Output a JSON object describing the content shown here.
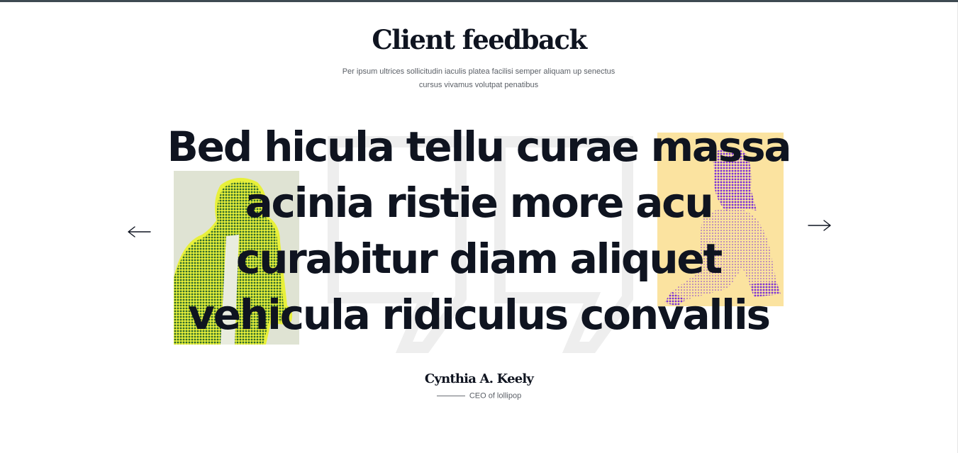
{
  "section": {
    "title": "Client feedback",
    "subtitle": "Per ipsum ultrices sollicitudin iaculis platea facilisi semper aliquam up senectus cursus vivamus volutpat penatibus"
  },
  "testimonial": {
    "quote": "Bed hicula tellu curae massa acinia ristie more acu curabitur diam aliquet vehicula ridiculus convallis",
    "author_name": "Cynthia A. Keely",
    "author_role": "CEO of lollipop"
  },
  "navigation": {
    "prev_icon": "arrow-left-icon",
    "next_icon": "arrow-right-icon"
  },
  "images": {
    "left": "halftone portrait of man in jacket, green tint",
    "right": "halftone portrait of woman sitting, purple tint"
  },
  "colors": {
    "text": "#0f1420",
    "muted": "#5a5f66",
    "top_rule": "#3e4a52",
    "quote_mark": "#eeeeee",
    "left_photo_bg": "#dfe3d3",
    "left_photo_ink": "#2f6b2c",
    "left_photo_glow": "#e8f03a",
    "right_photo_bg": "#fbe3a0",
    "right_photo_ink": "#7b2fd6"
  }
}
